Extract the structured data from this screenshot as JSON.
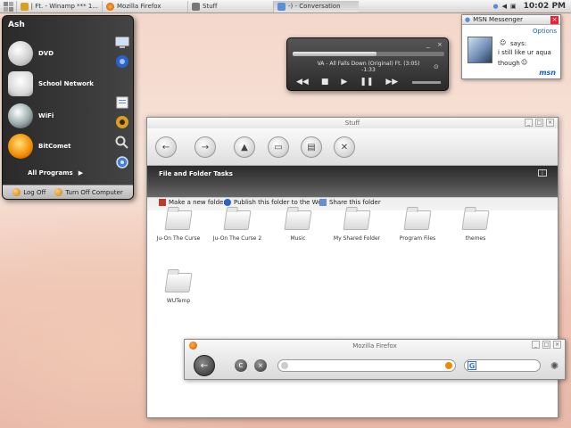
{
  "taskbar": {
    "items": [
      {
        "label": "| Ft. - Winamp *** 1..."
      },
      {
        "label": "Mozilla Firefox"
      },
      {
        "label": "Stuff"
      },
      {
        "label": "-) - Conversation"
      }
    ],
    "clock": "10:02 PM"
  },
  "start_menu": {
    "user": "Ash",
    "items": [
      {
        "label": "DVD"
      },
      {
        "label": "School Network"
      },
      {
        "label": "WiFi"
      },
      {
        "label": "BitComet"
      }
    ],
    "all_programs": "All Programs",
    "log_off": "Log Off",
    "turn_off": "Turn Off Computer"
  },
  "player": {
    "track": "VA - All Falls Down (Original) Ft. (3:05)",
    "time": "-1:33",
    "progress": 0.55
  },
  "msn": {
    "title": "MSN Messenger",
    "options": "Options",
    "says": "says:",
    "message_line1": "i still like ur aqua",
    "message_line2": "though",
    "logo": "msn"
  },
  "explorer": {
    "title": "Stuff",
    "tasks_title": "File and Folder Tasks",
    "tasks": [
      {
        "label": "Make a new folder"
      },
      {
        "label": "Publish this folder to the Web"
      },
      {
        "label": "Share this folder"
      }
    ],
    "folders": [
      {
        "label": "Ju-On The Curse"
      },
      {
        "label": "Ju-On The Curse 2"
      },
      {
        "label": "Music"
      },
      {
        "label": "My Shared Folder"
      },
      {
        "label": "Program Files"
      },
      {
        "label": "themes"
      },
      {
        "label": "WUTemp"
      }
    ]
  },
  "firefox": {
    "title": "Mozilla Firefox",
    "search_engine": "G"
  },
  "colors": {
    "menu_dark": "#2a2a2a",
    "msn_blue": "#1c5fc1",
    "firefox_orange": "#d34b00"
  }
}
